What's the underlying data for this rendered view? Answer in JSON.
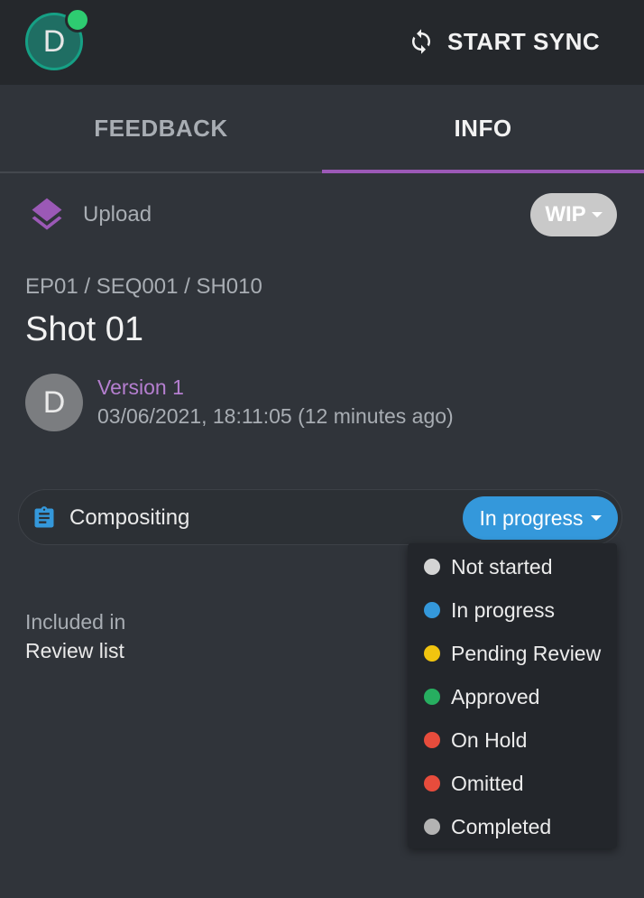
{
  "header": {
    "avatar_initial": "D",
    "sync_label": "START SYNC"
  },
  "tabs": [
    {
      "label": "FEEDBACK",
      "active": false
    },
    {
      "label": "INFO",
      "active": true
    }
  ],
  "upload": {
    "label": "Upload",
    "icon": "layers-icon",
    "status_label": "WIP"
  },
  "breadcrumb": "EP01 / SEQ001 / SH010",
  "title": "Shot 01",
  "version": {
    "avatar_initial": "D",
    "name": "Version 1",
    "date": "03/06/2021, 18:11:05 (12 minutes ago)"
  },
  "task": {
    "icon": "clipboard-icon",
    "name": "Compositing",
    "status": "In progress"
  },
  "status_menu": {
    "options": [
      {
        "label": "Not started",
        "color": "#d4d4d4"
      },
      {
        "label": "In progress",
        "color": "#3498db"
      },
      {
        "label": "Pending Review",
        "color": "#f1c40f"
      },
      {
        "label": "Approved",
        "color": "#27ae60"
      },
      {
        "label": "On Hold",
        "color": "#e74c3c"
      },
      {
        "label": "Omitted",
        "color": "#e74c3c"
      },
      {
        "label": "Completed",
        "color": "#b3b3b3"
      }
    ]
  },
  "included": {
    "label": "Included in",
    "value": "Review list"
  },
  "colors": {
    "accent": "#9b59b6",
    "status_in_progress": "#3498db",
    "online": "#2ecc71"
  }
}
